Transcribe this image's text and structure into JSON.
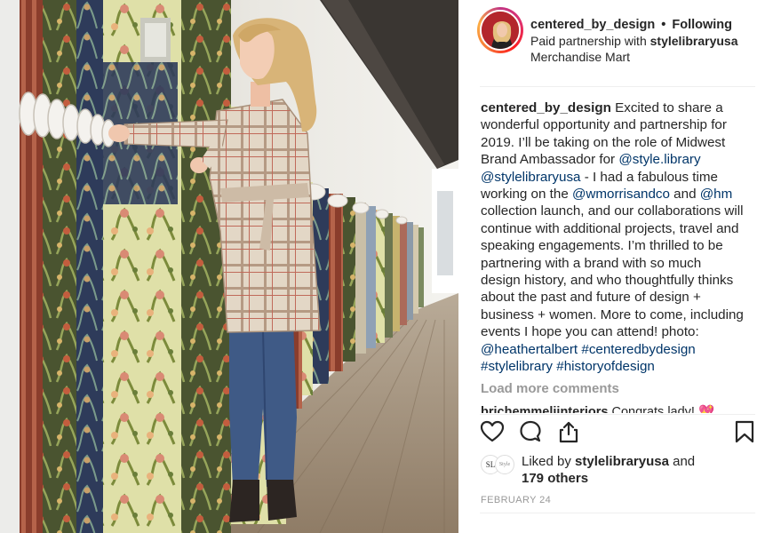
{
  "post": {
    "photo_alt": "Woman in plaid coat browsing hanging fabric and wallpaper samples"
  },
  "header": {
    "username": "centered_by_design",
    "separator": "•",
    "follow_status": "Following",
    "paid_prefix": "Paid partnership with ",
    "partner": "stylelibraryusa",
    "location": "Merchandise Mart"
  },
  "caption": {
    "username": "centered_by_design",
    "lines": [
      [
        {
          "t": "centered_by_design",
          "k": "user"
        },
        {
          "t": " Excited to share a",
          "k": "text"
        }
      ],
      [
        {
          "t": "wonderful opportunity and partnership for",
          "k": "text"
        }
      ],
      [
        {
          "t": "2019. I’ll be taking on the role of Midwest",
          "k": "text"
        }
      ],
      [
        {
          "t": "Brand Ambassador for ",
          "k": "text"
        },
        {
          "t": "@style.library",
          "k": "link"
        }
      ],
      [
        {
          "t": "@stylelibraryusa",
          "k": "link"
        },
        {
          "t": " - I had a fabulous time",
          "k": "text"
        }
      ],
      [
        {
          "t": "working on the ",
          "k": "text"
        },
        {
          "t": "@wmorrisandco",
          "k": "link"
        },
        {
          "t": " and ",
          "k": "text"
        },
        {
          "t": "@hm",
          "k": "link"
        }
      ],
      [
        {
          "t": "collection launch, and our collaborations will",
          "k": "text"
        }
      ],
      [
        {
          "t": "continue with additional projects, travel and",
          "k": "text"
        }
      ],
      [
        {
          "t": "speaking engagements. I’m thrilled to be",
          "k": "text"
        }
      ],
      [
        {
          "t": "partnering with a brand with so much",
          "k": "text"
        }
      ],
      [
        {
          "t": "design history, and who thoughtfully thinks",
          "k": "text"
        }
      ],
      [
        {
          "t": "about the past and future of design +",
          "k": "text"
        }
      ],
      [
        {
          "t": "business + women. More to come, including",
          "k": "text"
        }
      ],
      [
        {
          "t": "events I hope you can attend! photo:",
          "k": "text"
        }
      ],
      [
        {
          "t": "@heathertalbert",
          "k": "link"
        },
        {
          "t": " ",
          "k": "text"
        },
        {
          "t": "#centeredbydesign",
          "k": "link"
        }
      ],
      [
        {
          "t": "#stylelibrary",
          "k": "link"
        },
        {
          "t": " ",
          "k": "text"
        },
        {
          "t": "#historyofdesign",
          "k": "link"
        }
      ]
    ]
  },
  "comments": {
    "load_more_label": "Load more comments",
    "peek_user": "brichemmeliinteriors",
    "peek_text": " Congrats lady! 💖"
  },
  "actions": {
    "like_icon": "heart-icon",
    "comment_icon": "comment-icon",
    "share_icon": "share-icon",
    "save_icon": "bookmark-icon"
  },
  "likes": {
    "prefix": "Liked by ",
    "user": "stylelibraryusa",
    "and": " and",
    "others": "179 others",
    "avatar_1_text": "SL",
    "avatar_2_text": "Style"
  },
  "date": "FEBRUARY 24",
  "colors": {
    "link": "#003569",
    "muted": "#999999",
    "text": "#262626"
  }
}
